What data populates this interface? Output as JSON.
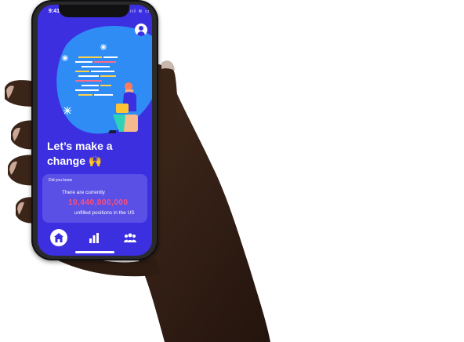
{
  "status_bar": {
    "time": "9:41",
    "icons": "ııl ≋ ▭"
  },
  "header": {
    "avatar_icon": "user-circle-icon"
  },
  "hero": {
    "illustration": "developer-at-laptop-illustration"
  },
  "headline": {
    "text": "Let’s make a change 🙌"
  },
  "fact_card": {
    "title": "Did you know",
    "line1": "There are currently",
    "number": "10,440,000,000",
    "line2": "unfilled positions in the US"
  },
  "tab_bar": {
    "items": [
      {
        "icon": "home-icon",
        "active": true
      },
      {
        "icon": "bar-chart-icon",
        "active": false
      },
      {
        "icon": "people-icon",
        "active": false
      }
    ]
  },
  "colors": {
    "screen_bg": "#3b2fe0",
    "blob": "#2f8cf5",
    "highlight_number": "#ff4f7d",
    "skin": "#3b2519"
  }
}
